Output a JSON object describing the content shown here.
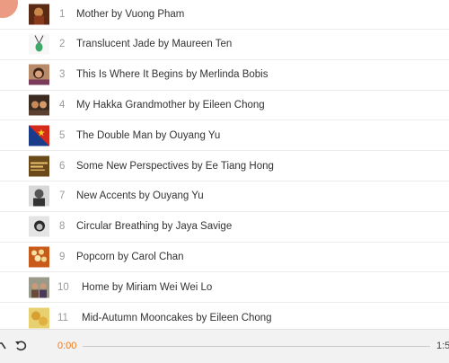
{
  "tracks": [
    {
      "number": "1",
      "title": "Mother by Vuong Pham"
    },
    {
      "number": "2",
      "title": "Translucent Jade by Maureen Ten"
    },
    {
      "number": "3",
      "title": "This Is Where It Begins by Merlinda Bobis"
    },
    {
      "number": "4",
      "title": "My Hakka Grandmother by Eileen Chong"
    },
    {
      "number": "5",
      "title": "The Double Man by Ouyang Yu"
    },
    {
      "number": "6",
      "title": "Some New Perspectives by Ee Tiang Hong",
      "thumb_text": "Some New..."
    },
    {
      "number": "7",
      "title": "New Accents by Ouyang Yu"
    },
    {
      "number": "8",
      "title": "Circular Breathing by Jaya Savige"
    },
    {
      "number": "9",
      "title": "Popcorn by Carol Chan"
    },
    {
      "number": "10",
      "title": "Home by Miriam Wei Wei Lo"
    },
    {
      "number": "11",
      "title": "Mid-Autumn Mooncakes by Eileen Chong"
    }
  ],
  "player": {
    "current_time": "0:00",
    "total_time": "1:5",
    "progress": 0,
    "shuffle_icon": "shuffle-icon",
    "repeat_icon": "repeat-icon",
    "accent_color": "#f07a1a"
  }
}
